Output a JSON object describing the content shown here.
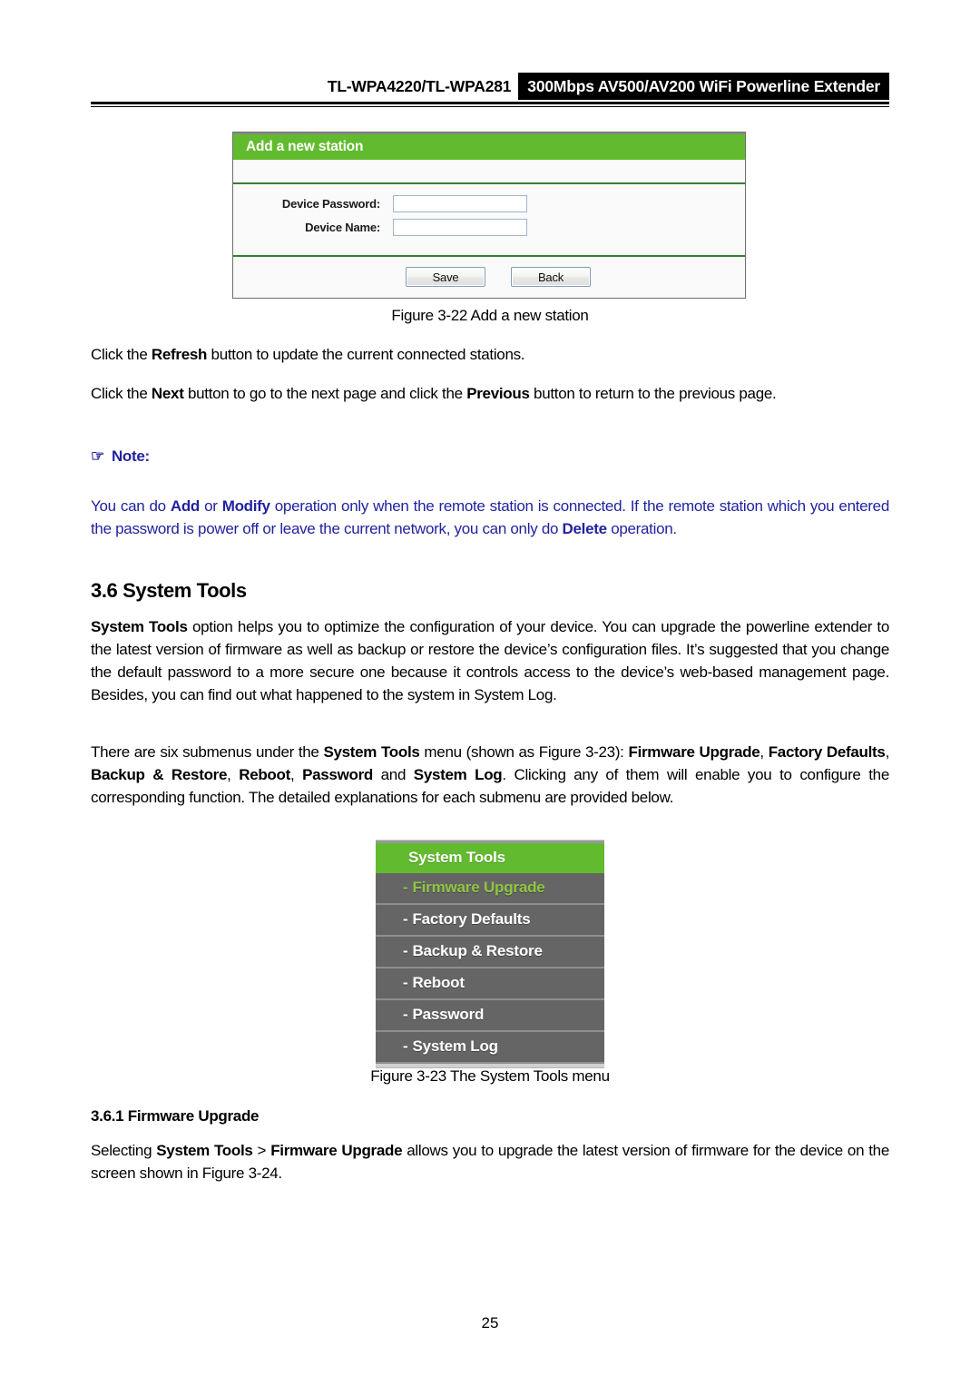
{
  "header": {
    "model": "TL-WPA4220/TL-WPA281",
    "product_banner": "300Mbps AV500/AV200 WiFi Powerline Extender"
  },
  "figure_add_station": {
    "panel_title": "Add a new station",
    "fields": [
      {
        "label": "Device Password:",
        "value": "",
        "placeholder": ""
      },
      {
        "label": "Device Name:",
        "value": "",
        "placeholder": ""
      }
    ],
    "buttons": {
      "save": "Save",
      "back": "Back"
    },
    "caption": "Figure 3-22 Add a new station"
  },
  "paragraphs": {
    "refresh": {
      "pre": "Click the ",
      "bold1": "Refresh",
      "post": " button to update the current connected stations."
    },
    "nextprev": {
      "pre": "Click the ",
      "bold1": "Next",
      "mid": " button to go to the next page and click the ",
      "bold2": "Previous",
      "post": " button to return to the previous page."
    }
  },
  "note": {
    "icon": "pointing-hand-icon",
    "icon_glyph": "☞",
    "title": "Note:",
    "t1": "You can do ",
    "b1": "Add",
    "t2": " or ",
    "b2": "Modify",
    "t3": " operation only when the remote station is connected. If the remote station which you entered the password is power off or leave the current network, you can only do ",
    "b3": "Delete",
    "t4": " operation.",
    "color": "#2222a0"
  },
  "section": {
    "heading": "3.6 System Tools",
    "intro": {
      "b1": "System Tools",
      "t1": " option helps you to optimize the configuration of your device. You can upgrade the powerline extender to the latest version of firmware as well as backup or restore the device’s configuration files. It’s suggested that you change the default password to a more secure one because it controls access to the device’s web-based management page. Besides, you can find out what happened to the system in System Log."
    },
    "submenus_para": {
      "t1": "There are six submenus under the ",
      "b1": "System Tools",
      "t2": " menu (shown as Figure 3-23): ",
      "b2": "Firmware Upgrade",
      "t3": ", ",
      "b3": "Factory Defaults",
      "t4": ", ",
      "b4": "Backup & Restore",
      "t5": ", ",
      "b5": "Reboot",
      "t6": ", ",
      "b6": "Password",
      "t7": " and ",
      "b7": "System Log",
      "t8": ". Clicking any of them will enable you to configure the corresponding function. The detailed explanations for each submenu are provided below."
    }
  },
  "figure_menu": {
    "header_label": "System Tools",
    "items": [
      {
        "dash": "-",
        "label": "Firmware Upgrade",
        "active": true
      },
      {
        "dash": "-",
        "label": "Factory Defaults",
        "active": false
      },
      {
        "dash": "-",
        "label": "Backup & Restore",
        "active": false
      },
      {
        "dash": "-",
        "label": "Reboot",
        "active": false
      },
      {
        "dash": "-",
        "label": "Password",
        "active": false
      },
      {
        "dash": "-",
        "label": "System Log",
        "active": false
      }
    ],
    "caption": "Figure 3-23 The System Tools menu",
    "colors": {
      "header_green": "#62bb2e",
      "item_gray": "#656565",
      "active_text": "#8ec63f"
    }
  },
  "subsection": {
    "heading": "3.6.1 Firmware Upgrade",
    "body": {
      "t1": "Selecting ",
      "b1": "System Tools",
      "t2": " > ",
      "b2": "Firmware Upgrade",
      "t3": " allows you to upgrade the latest version of firmware for the device on the screen shown in Figure 3-24."
    }
  },
  "footer": {
    "page_number": "25"
  }
}
